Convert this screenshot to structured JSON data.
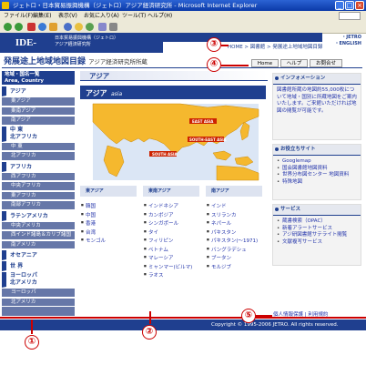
{
  "window": {
    "title": "ジェトロ・日本貿易振興機構（ジェトロ）アジア経済研究所 - Microsoft Internet Explorer",
    "menu": [
      "ファイル(F)",
      "編集(E)",
      "表示(V)",
      "お気に入り(A)",
      "ツール(T)",
      "ヘルプ(H)"
    ]
  },
  "header": {
    "logo": "IDE-JETRO",
    "org_line1": "日本貿易振興機構（ジェトロ）",
    "org_line2": "アジア経済研究所",
    "nav_right_1": "・JETRO",
    "nav_right_2": "・ENGLISH",
    "breadcrumb": "HOME > 図書館 > 発展途上地域地図目録",
    "page_title": "発展途上地域地図目録",
    "page_subtitle": "アジア経済研究所所蔵",
    "buttons": [
      "Home",
      "ヘルプ",
      "お問合せ"
    ]
  },
  "sidebar": {
    "heading_line1": "地域・国名一覧",
    "heading_line2": "Area, Country",
    "items": [
      {
        "label": "アジア",
        "type": "main"
      },
      {
        "label": "東アジア",
        "type": "sub"
      },
      {
        "label": "東南アジア",
        "type": "sub"
      },
      {
        "label": "南アジア",
        "type": "sub"
      },
      {
        "label": "中 東\n北アフリカ",
        "type": "main"
      },
      {
        "label": "中 東",
        "type": "sub"
      },
      {
        "label": "北アフリカ",
        "type": "sub"
      },
      {
        "label": "アフリカ",
        "type": "main"
      },
      {
        "label": "西アフリカ",
        "type": "sub"
      },
      {
        "label": "中央アフリカ",
        "type": "sub"
      },
      {
        "label": "東アフリカ",
        "type": "sub"
      },
      {
        "label": "南部アフリカ",
        "type": "sub"
      },
      {
        "label": "ラテンアメリカ",
        "type": "main"
      },
      {
        "label": "中央アメリカ",
        "type": "sub"
      },
      {
        "label": "西インド諸島＆カリブ諸国",
        "type": "sub"
      },
      {
        "label": "南アメリカ",
        "type": "sub"
      },
      {
        "label": "オセアニア",
        "type": "main"
      },
      {
        "label": "世 界",
        "type": "main"
      },
      {
        "label": "ヨーロッパ\n北アメリカ",
        "type": "main"
      },
      {
        "label": "ヨーロッパ",
        "type": "sub"
      },
      {
        "label": "北アメリカ",
        "type": "sub"
      }
    ]
  },
  "main": {
    "section_title": "アジア",
    "map_title": "アジア",
    "map_title_en": "asia",
    "map_labels": [
      "EAST ASIA",
      "SOUTH-EAST ASIA",
      "SOUTH ASIA"
    ],
    "columns": [
      {
        "heading": "東アジア",
        "items": [
          "韓国",
          "中国",
          "香港",
          "台湾",
          "モンゴル"
        ]
      },
      {
        "heading": "東南アジア",
        "items": [
          "インドネシア",
          "カンボジア",
          "シンガポール",
          "タイ",
          "フィリピン",
          "ベトナム",
          "マレーシア",
          "ミャンマー(ビルマ)",
          "ラオス"
        ]
      },
      {
        "heading": "南アジア",
        "items": [
          "インド",
          "スリランカ",
          "ネパール",
          "パキスタン",
          "パキスタン(～1971)",
          "バングラデシュ",
          "ブータン",
          "モルジブ"
        ]
      }
    ]
  },
  "right_panels": {
    "info": {
      "heading": "インフォメーション",
      "text": "図書館所蔵の地図約55,000枚について地域・国別に所蔵地図をご案内いたします。ご来館いただければ地図の閲覧が可能です。"
    },
    "links": {
      "heading": "お役立ちサイト",
      "items": [
        "Googlemap",
        "国会図書館地図資料",
        "世界分布図センター 地図資料",
        "特殊地図"
      ]
    },
    "services": {
      "heading": "サービス",
      "items": [
        "蔵書検索（OPAC）",
        "新着アラートサービス",
        "アジ研図書館サテライト閲覧",
        "文献複写サービス"
      ]
    }
  },
  "footer": {
    "links": "個人情報保護 | 利用規約",
    "copyright": "Copyright © 1995-2006 JETRO. All rights reserved."
  },
  "annotations": [
    "①",
    "②",
    "③",
    "④",
    "⑤"
  ],
  "colors": {
    "brand": "#1f3f8f",
    "annotation": "#cc0000",
    "map_land": "#f5b82e",
    "map_sea": "#ffffff"
  }
}
